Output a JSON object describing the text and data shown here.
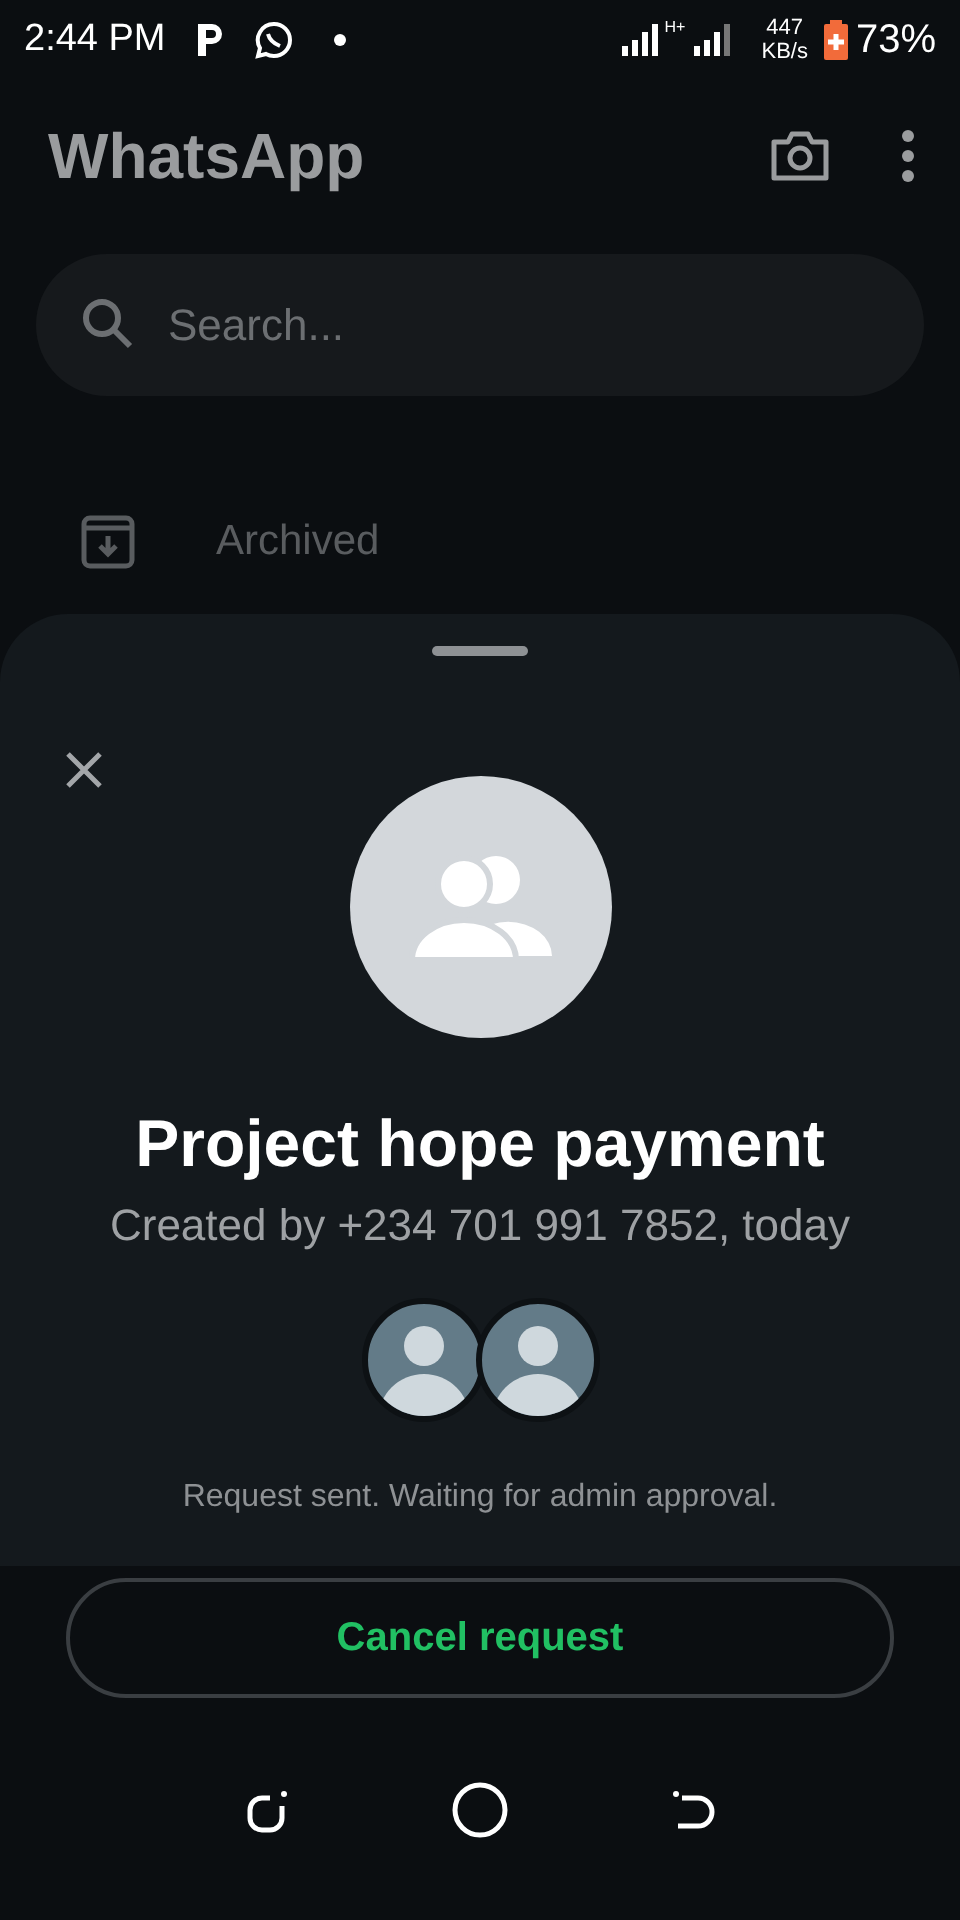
{
  "status_bar": {
    "time": "2:44 PM",
    "network_type": "H+",
    "speed_value": "447",
    "speed_unit": "KB/s",
    "battery_percent": "73%"
  },
  "header": {
    "title": "WhatsApp"
  },
  "search": {
    "placeholder": "Search..."
  },
  "archived": {
    "label": "Archived"
  },
  "sheet": {
    "group_name": "Project hope payment",
    "created_by": "Created by +234 701 991 7852, today",
    "members": [
      {
        "kind": "default_avatar"
      },
      {
        "kind": "default_avatar"
      }
    ],
    "status_text": "Request sent. Waiting for admin approval.",
    "action_button": "Cancel request"
  }
}
